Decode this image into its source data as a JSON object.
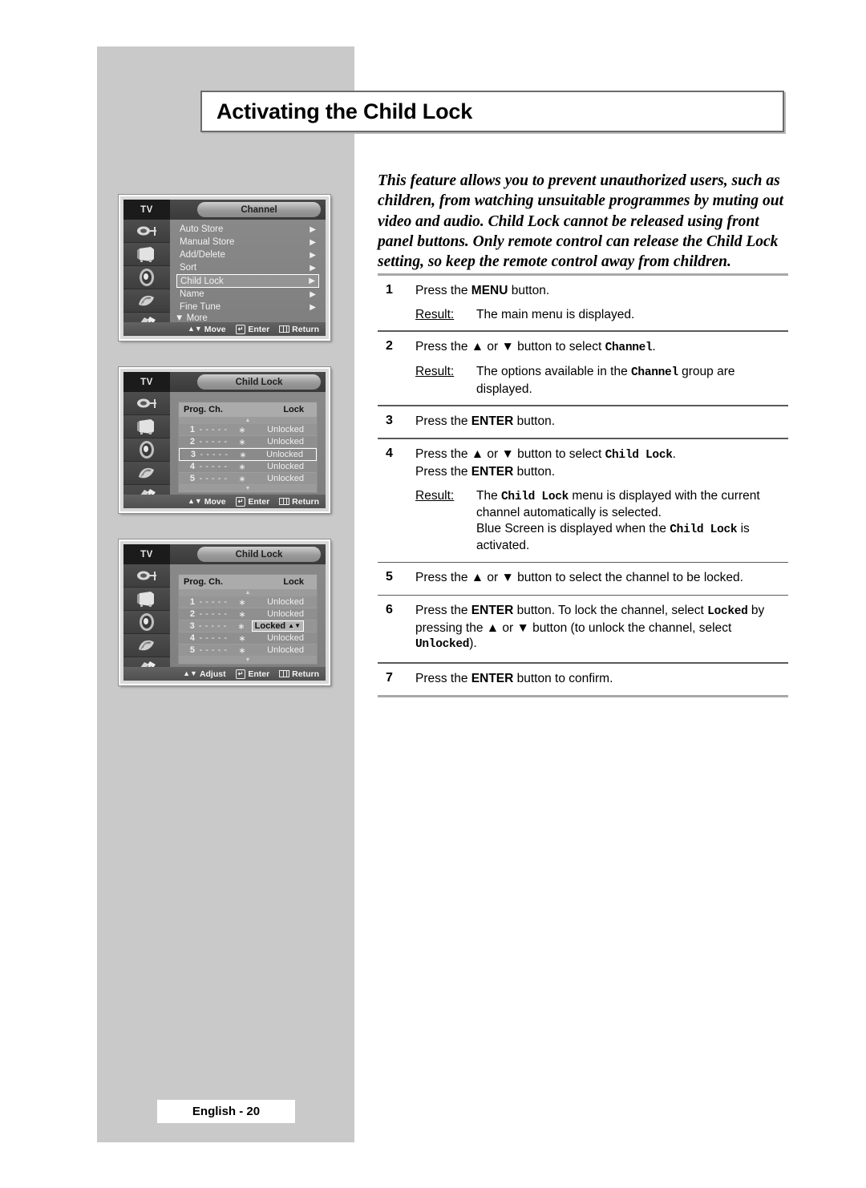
{
  "page": {
    "title": "Activating the Child Lock",
    "footer": "English - 20",
    "intro": "This feature allows you to prevent unauthorized users, such as children, from watching unsuitable programmes by muting out video and audio. Child Lock cannot be released using front panel buttons. Only remote control can release the Child Lock setting, so keep the remote control away from children."
  },
  "steps": [
    {
      "num": "1",
      "lines": [
        "Press the |MENU| button."
      ],
      "result_label": "Result:",
      "result_lines": [
        "The main menu is displayed."
      ]
    },
    {
      "num": "2",
      "lines": [
        "Press the ▲ or ▼ button to select [Channel]."
      ],
      "result_label": "Result:",
      "result_lines": [
        "The options available in the [Channel] group are displayed."
      ]
    },
    {
      "num": "3",
      "lines": [
        "Press the |ENTER| button."
      ],
      "result_label": "",
      "result_lines": []
    },
    {
      "num": "4",
      "lines": [
        "Press the ▲ or ▼ button to select [Child Lock].",
        "Press the |ENTER| button."
      ],
      "result_label": "Result:",
      "result_lines": [
        "The [Child Lock] menu is displayed with the current channel automatically is selected.",
        "Blue Screen is displayed when the [Child Lock] is activated."
      ]
    },
    {
      "num": "5",
      "lines": [
        "Press the ▲ or ▼ button to select the channel to be locked."
      ],
      "result_label": "",
      "result_lines": []
    },
    {
      "num": "6",
      "lines": [
        "Press the |ENTER| button. To lock the channel, select [Locked] by pressing the ▲ or ▼ button (to unlock the channel, select [Unlocked])."
      ],
      "result_label": "",
      "result_lines": []
    },
    {
      "num": "7",
      "lines": [
        "Press the |ENTER| button to confirm."
      ],
      "result_label": "",
      "result_lines": []
    }
  ],
  "osd_common": {
    "tv_label": "TV",
    "icons": [
      "antenna-icon",
      "picture-icon",
      "sound-icon",
      "setup-icon",
      "special-icon"
    ],
    "help_enter": "Enter",
    "help_return": "Return"
  },
  "osd1": {
    "tab": "Channel",
    "items": [
      {
        "label": "Auto Store",
        "arrow": "▶",
        "selected": false
      },
      {
        "label": "Manual Store",
        "arrow": "▶",
        "selected": false
      },
      {
        "label": "Add/Delete",
        "arrow": "▶",
        "selected": false
      },
      {
        "label": "Sort",
        "arrow": "▶",
        "selected": false
      },
      {
        "label": "Child Lock",
        "arrow": "▶",
        "selected": true
      },
      {
        "label": "Name",
        "arrow": "▶",
        "selected": false
      },
      {
        "label": "Fine Tune",
        "arrow": "▶",
        "selected": false
      }
    ],
    "more": "▼  More",
    "help_move": "Move"
  },
  "osd2": {
    "tab": "Child Lock",
    "head_prog": "Prog.  Ch.",
    "head_lock": "Lock",
    "rows": [
      {
        "num": "1",
        "dash": "- - - - -",
        "star": "∗",
        "lock": "Unlocked",
        "selected": false
      },
      {
        "num": "2",
        "dash": "- - - - -",
        "star": "∗",
        "lock": "Unlocked",
        "selected": false
      },
      {
        "num": "3",
        "dash": "- - - - -",
        "star": "∗",
        "lock": "Unlocked",
        "selected": true
      },
      {
        "num": "4",
        "dash": "- - - - -",
        "star": "∗",
        "lock": "Unlocked",
        "selected": false
      },
      {
        "num": "5",
        "dash": "- - - - -",
        "star": "∗",
        "lock": "Unlocked",
        "selected": false
      }
    ],
    "help_move": "Move"
  },
  "osd3": {
    "tab": "Child Lock",
    "head_prog": "Prog.  Ch.",
    "head_lock": "Lock",
    "rows": [
      {
        "num": "1",
        "dash": "- - - - -",
        "star": "∗",
        "lock": "Unlocked",
        "chip": false
      },
      {
        "num": "2",
        "dash": "- - - - -",
        "star": "∗",
        "lock": "Unlocked",
        "chip": false
      },
      {
        "num": "3",
        "dash": "- - - - -",
        "star": "∗",
        "lock": "Locked",
        "chip": true
      },
      {
        "num": "4",
        "dash": "- - - - -",
        "star": "∗",
        "lock": "Unlocked",
        "chip": false
      },
      {
        "num": "5",
        "dash": "- - - - -",
        "star": "∗",
        "lock": "Unlocked",
        "chip": false
      }
    ],
    "help_move": "Adjust"
  }
}
